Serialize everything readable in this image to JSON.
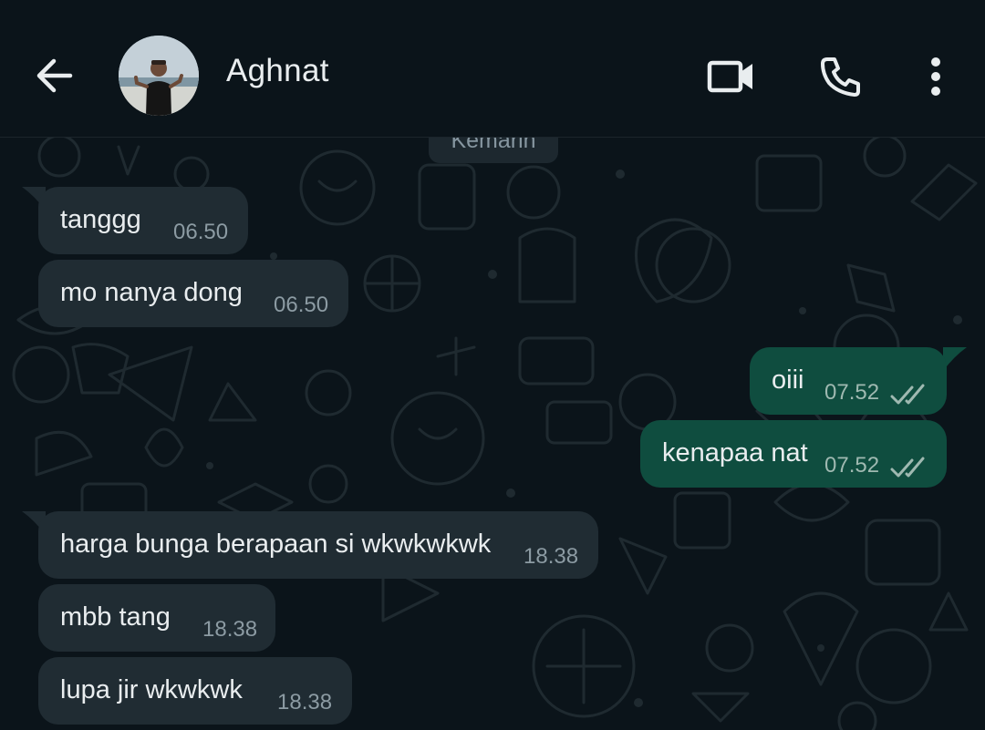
{
  "header": {
    "contact_name": "Aghnat",
    "back_icon": "arrow-back-icon",
    "video_icon": "video-call-icon",
    "call_icon": "phone-icon",
    "menu_icon": "more-vert-icon"
  },
  "chat": {
    "date_chip": "Kemarin",
    "messages": [
      {
        "direction": "in",
        "text": "tanggg",
        "time": "06.50"
      },
      {
        "direction": "in",
        "text": "mo nanya dong",
        "time": "06.50"
      },
      {
        "direction": "out",
        "text": "oiii",
        "time": "07.52",
        "status": "read"
      },
      {
        "direction": "out",
        "text": "kenapaa nat",
        "time": "07.52",
        "status": "read"
      },
      {
        "direction": "in",
        "text": "harga bunga berapaan si wkwkwkwk",
        "time": "18.38"
      },
      {
        "direction": "in",
        "text": "mbb tang",
        "time": "18.38"
      },
      {
        "direction": "in",
        "text": "lupa jir wkwkwk",
        "time": "18.38"
      }
    ]
  },
  "colors": {
    "background": "#0b141a",
    "incoming_bubble": "#202c33",
    "outgoing_bubble": "#0f4d3f",
    "text": "#e9edef",
    "timestamp": "#8c9ba3",
    "read_ticks": "#9fb9b1"
  }
}
